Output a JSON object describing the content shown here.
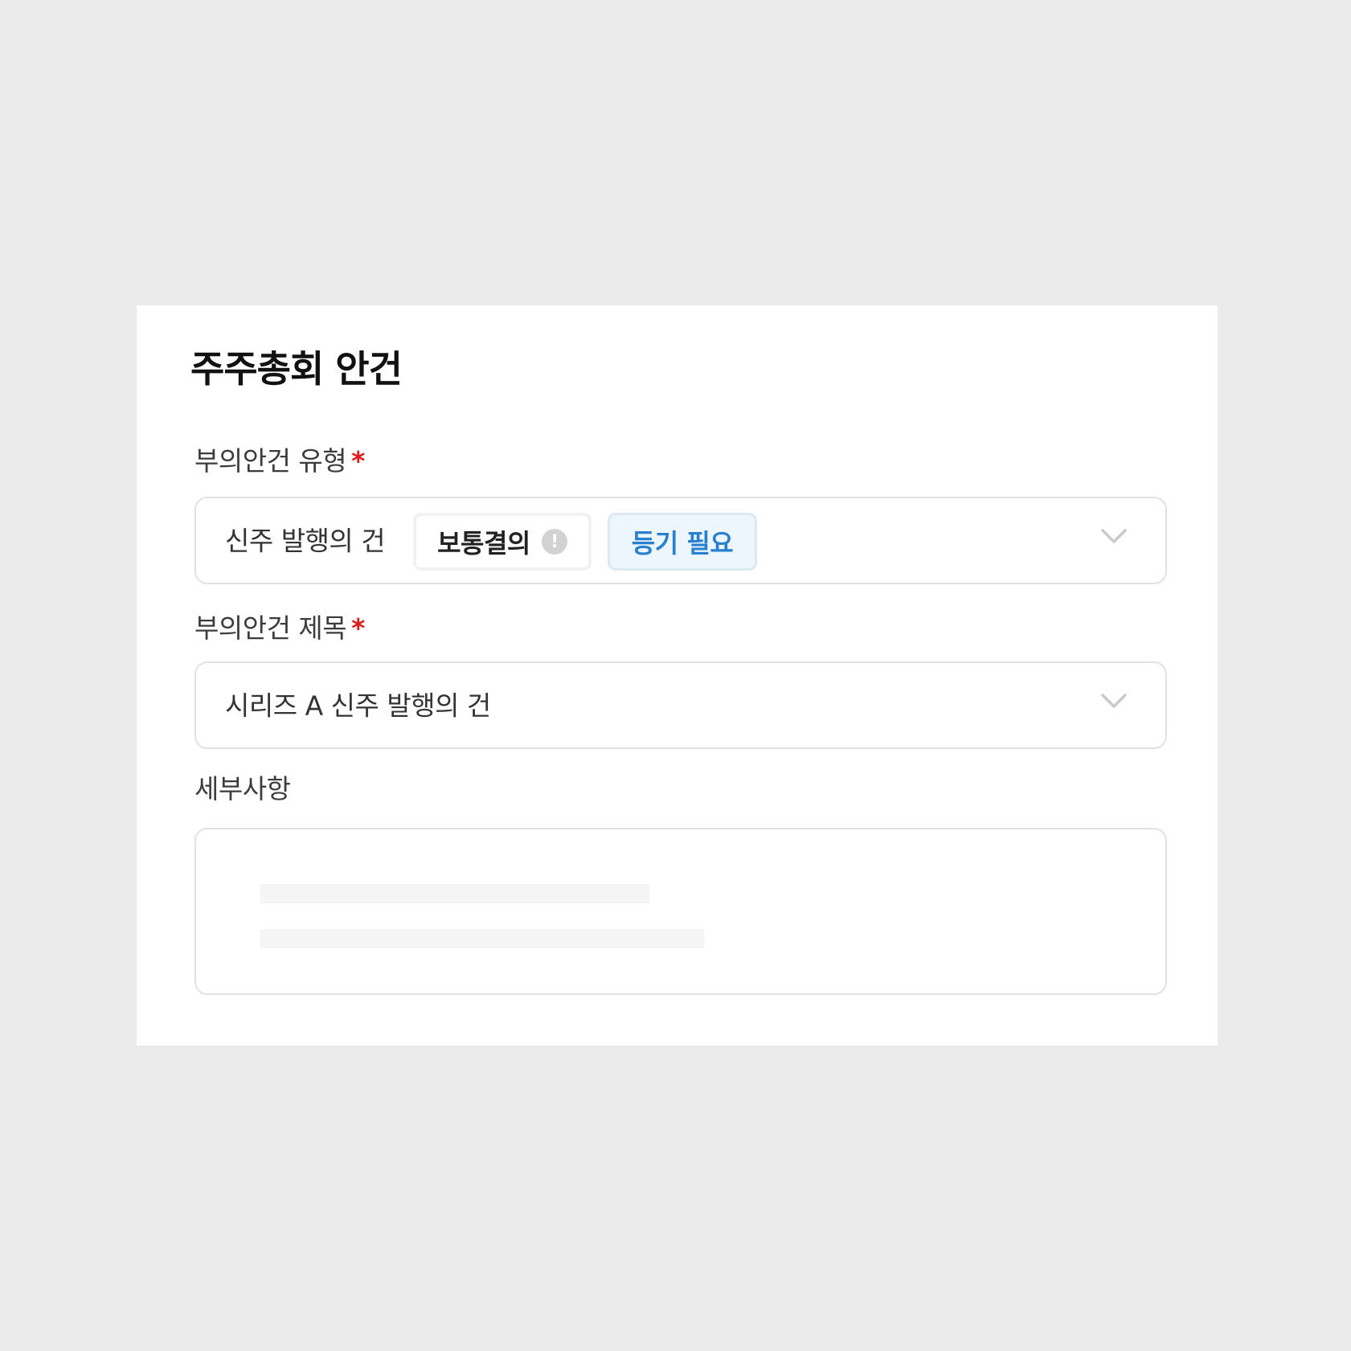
{
  "card": {
    "title": "주주총회 안건"
  },
  "agenda_type": {
    "label": "부의안건 유형",
    "required_mark": "*",
    "value": "신주 발행의 건",
    "resolution_chip": "보통결의",
    "resolution_info_glyph": "!",
    "registry_chip": "등기 필요",
    "chevron_icon": "chevron-down-icon"
  },
  "agenda_title": {
    "label": "부의안건 제목",
    "required_mark": "*",
    "value": "시리즈 A 신주 발행의 건",
    "chevron_icon": "chevron-down-icon"
  },
  "details": {
    "label": "세부사항",
    "placeholder_line_count": 2
  },
  "colors": {
    "page_background": "#ebebeb",
    "card_background": "#ffffff",
    "required_mark": "#e11a1a",
    "registry_chip_text": "#2880d0",
    "registry_chip_background": "#edf5fd",
    "border": "#e2e2e2"
  }
}
